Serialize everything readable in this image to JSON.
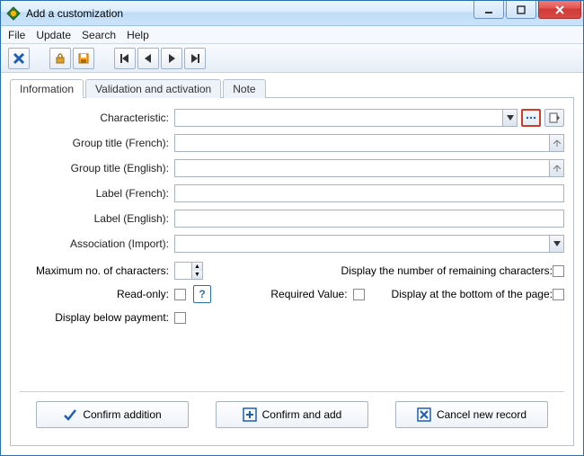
{
  "window": {
    "title": "Add a customization"
  },
  "menu": {
    "file": "File",
    "update": "Update",
    "search": "Search",
    "help": "Help"
  },
  "tabs": {
    "information": "Information",
    "validation": "Validation and activation",
    "note": "Note"
  },
  "form": {
    "characteristic_label": "Characteristic:",
    "group_fr_label": "Group title (French):",
    "group_en_label": "Group title (English):",
    "label_fr_label": "Label (French):",
    "label_en_label": "Label (English):",
    "association_label": "Association (Import):"
  },
  "options": {
    "max_chars_label": "Maximum no. of characters:",
    "display_remaining_label": "Display the number of remaining characters:",
    "readonly_label": "Read-only:",
    "required_label": "Required Value:",
    "display_bottom_label": "Display at the bottom of the page:",
    "display_below_payment_label": "Display below payment:"
  },
  "buttons": {
    "confirm": "Confirm addition",
    "confirm_add": "Confirm and add",
    "cancel": "Cancel new record"
  }
}
